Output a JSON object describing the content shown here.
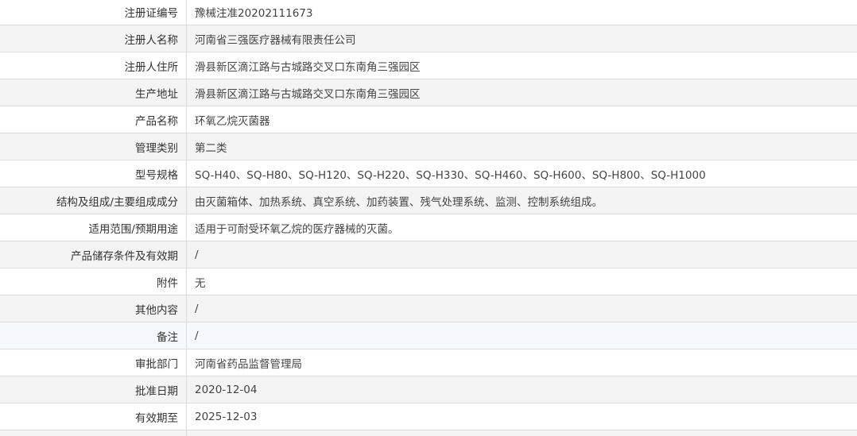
{
  "rows": [
    {
      "label": "注册证编号",
      "value": "豫械注准20202111673"
    },
    {
      "label": "注册人名称",
      "value": "河南省三强医疗器械有限责任公司"
    },
    {
      "label": "注册人住所",
      "value": "滑县新区滴江路与古城路交叉口东南角三强园区"
    },
    {
      "label": "生产地址",
      "value": "滑县新区滴江路与古城路交叉口东南角三强园区"
    },
    {
      "label": "产品名称",
      "value": "环氧乙烷灭菌器"
    },
    {
      "label": "管理类别",
      "value": "第二类"
    },
    {
      "label": "型号规格",
      "value": "SQ-H40、SQ-H80、SQ-H120、SQ-H220、SQ-H330、SQ-H460、SQ-H600、SQ-H800、SQ-H1000"
    },
    {
      "label": "结构及组成/主要组成成分",
      "value": "由灭菌箱体、加热系统、真空系统、加药装置、残气处理系统、监测、控制系统组成。"
    },
    {
      "label": "适用范围/预期用途",
      "value": "适用于可耐受环氧乙烷的医疗器械的灭菌。"
    },
    {
      "label": "产品储存条件及有效期",
      "value": "/"
    },
    {
      "label": "附件",
      "value": "无"
    },
    {
      "label": "其他内容",
      "value": "/"
    },
    {
      "label": "备注",
      "value": "/"
    },
    {
      "label": "审批部门",
      "value": "河南省药品监督管理局"
    },
    {
      "label": "批准日期",
      "value": "2020-12-04"
    },
    {
      "label": "有效期至",
      "value": "2025-12-03"
    },
    {
      "label": "",
      "value": ""
    }
  ]
}
